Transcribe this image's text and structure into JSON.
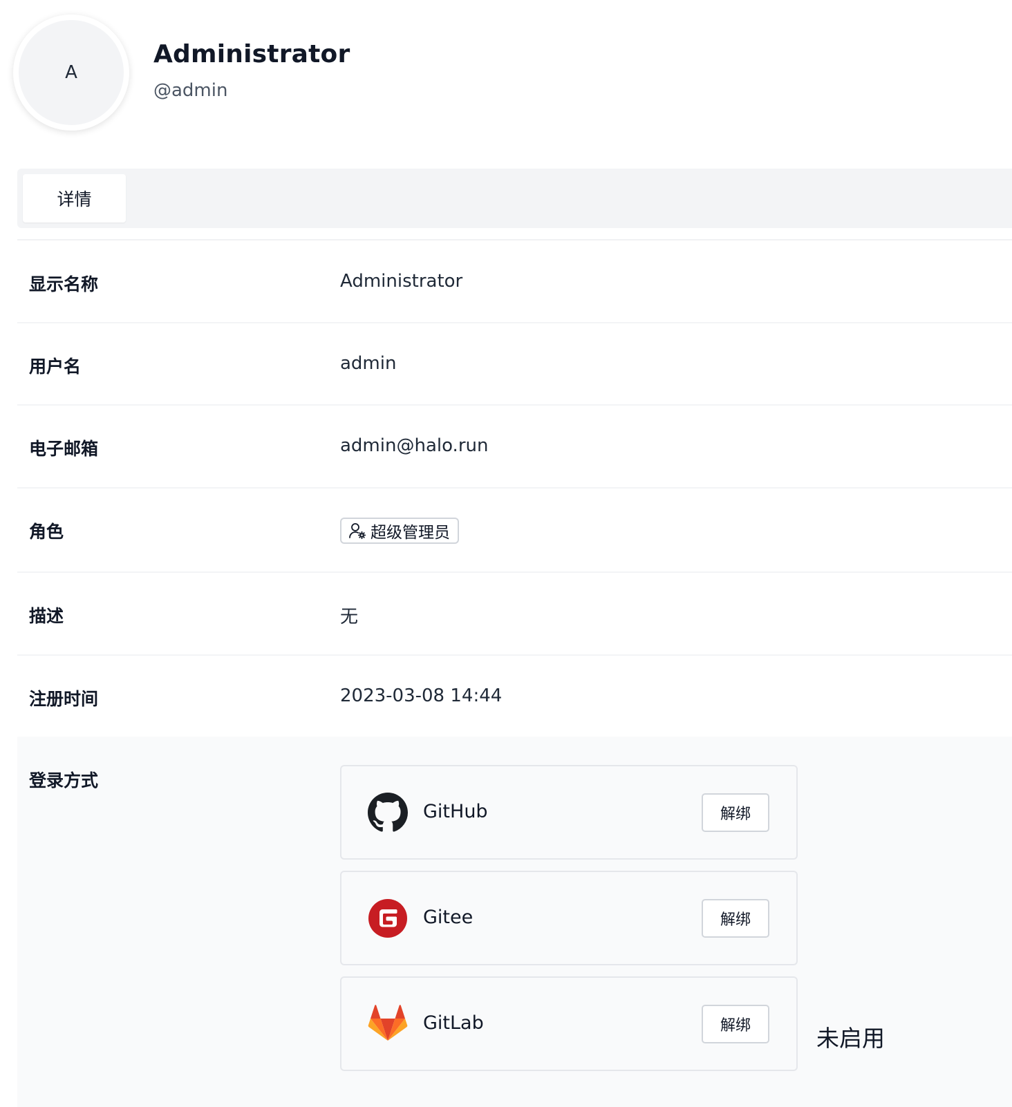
{
  "profile": {
    "avatar_initial": "A",
    "display_name": "Administrator",
    "handle": "@admin"
  },
  "tabs": [
    {
      "label": "详情",
      "active": true
    }
  ],
  "details": {
    "display_name": {
      "label": "显示名称",
      "value": "Administrator"
    },
    "username": {
      "label": "用户名",
      "value": "admin"
    },
    "email": {
      "label": "电子邮箱",
      "value": "admin@halo.run"
    },
    "role": {
      "label": "角色",
      "value": "超级管理员",
      "icon": "user-gear-icon"
    },
    "description": {
      "label": "描述",
      "value": "无"
    },
    "registered": {
      "label": "注册时间",
      "value": "2023-03-08 14:44"
    }
  },
  "login_methods": {
    "label": "登录方式",
    "providers": [
      {
        "name": "GitHub",
        "icon": "github-icon",
        "action": "解绑"
      },
      {
        "name": "Gitee",
        "icon": "gitee-icon",
        "action": "解绑",
        "brand_color": "#C71D23"
      },
      {
        "name": "GitLab",
        "icon": "gitlab-icon",
        "action": "解绑",
        "brand_color": "#FC6D26"
      }
    ],
    "disabled_note": "未启用"
  },
  "colors": {
    "text_primary": "#111827",
    "text_secondary": "#4b5563",
    "tab_bar_bg": "#f3f4f6",
    "section_bg": "#f9fafb",
    "border": "#e5e7eb"
  }
}
